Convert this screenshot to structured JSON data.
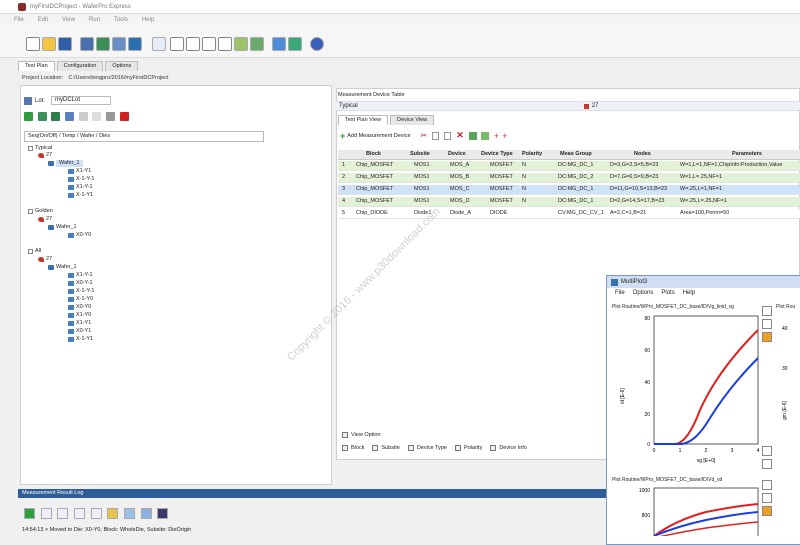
{
  "window": {
    "title": "myFirstDCProject - WaferPro Express"
  },
  "menubar": [
    "File",
    "Edit",
    "View",
    "Run",
    "Tools",
    "Help"
  ],
  "tabs": [
    "Test Plan",
    "Configuration",
    "Options"
  ],
  "project_location": {
    "label": "Project Location:",
    "value": "C:/Users/tengpro/2016/myFirstDCProject"
  },
  "lot": {
    "label": "Lot:",
    "value": "myDCLot"
  },
  "hierarchy_select": "Seq(On/Off) / Temp / Wafer / Dies",
  "tree": [
    {
      "label": "Typical",
      "level": 0
    },
    {
      "label": "27",
      "level": 1
    },
    {
      "label": "Wafer_1",
      "level": 2,
      "selected": true
    },
    {
      "label": "X1-Y1",
      "level": 3
    },
    {
      "label": "X-1-Y-1",
      "level": 3
    },
    {
      "label": "X1-Y-1",
      "level": 3
    },
    {
      "label": "X-1-Y1",
      "level": 3
    },
    {
      "label": "Golden",
      "level": 0
    },
    {
      "label": "27",
      "level": 1
    },
    {
      "label": "Wafer_1",
      "level": 2
    },
    {
      "label": "X0-Y0",
      "level": 3
    },
    {
      "label": "All",
      "level": 0
    },
    {
      "label": "27",
      "level": 1
    },
    {
      "label": "Wafer_1",
      "level": 2
    },
    {
      "label": "X1-Y-1",
      "level": 3
    },
    {
      "label": "X0-Y-1",
      "level": 3
    },
    {
      "label": "X-1-Y-1",
      "level": 3
    },
    {
      "label": "X-1-Y0",
      "level": 3
    },
    {
      "label": "X0-Y0",
      "level": 3
    },
    {
      "label": "X1-Y0",
      "level": 3
    },
    {
      "label": "X1-Y1",
      "level": 3
    },
    {
      "label": "X0-Y1",
      "level": 3
    },
    {
      "label": "X-1-Y1",
      "level": 3
    }
  ],
  "mdt": {
    "title": "Measurement Device Table",
    "typical": "Typical",
    "temp": "27"
  },
  "rtabs": [
    "Test Plan View",
    "Device View"
  ],
  "add_device": "Add Measurement Device",
  "grid": {
    "headers": [
      "Block",
      "Subsite",
      "Device",
      "Device Type",
      "Polarity",
      "Meas Group",
      "Nodes",
      "Parameters"
    ],
    "rows": [
      {
        "n": "1",
        "block": "Chip_MOSFET",
        "subsite": "MOS1",
        "device": "MOS_A",
        "type": "MOSFET",
        "pol": "N",
        "group": "DC:MG_DC_1",
        "nodes": "D=3,G=2,S=5,B=23",
        "params": "W=1,L=1,NF=1,ChipInfo:Production,Value"
      },
      {
        "n": "2",
        "block": "Chip_MOSFET",
        "subsite": "MOS1",
        "device": "MOS_B",
        "type": "MOSFET",
        "pol": "N",
        "group": "DC:MG_DC_2",
        "nodes": "D=7,G=6,S=9,B=23",
        "params": "W=1,L=.25,NF=1"
      },
      {
        "n": "3",
        "block": "Chip_MOSFET",
        "subsite": "MOS1",
        "device": "MOS_C",
        "type": "MOSFET",
        "pol": "N",
        "group": "DC:MG_DC_1",
        "nodes": "D=11,G=10,S=13,B=23",
        "params": "W=.25,L=1,NF=1"
      },
      {
        "n": "4",
        "block": "Chip_MOSFET",
        "subsite": "MOS1",
        "device": "MOS_D",
        "type": "MOSFET",
        "pol": "N",
        "group": "DC:MG_DC_1",
        "nodes": "D=2,G=14,S=17,B=23",
        "params": "W=.25,L=.25,NF=1"
      },
      {
        "n": "5",
        "block": "Chip_DIODE",
        "subsite": "Diode1",
        "device": "Diode_A",
        "type": "DIODE",
        "pol": "",
        "group": "CV:MG_DC_CV_1",
        "nodes": "A=2,C=1,B=21",
        "params": "Area=100,Perim=50"
      }
    ]
  },
  "view_option": "View Option",
  "col_options": [
    "Block",
    "Subsite",
    "Device Type",
    "Polarity",
    "Device Info"
  ],
  "log": {
    "title": "Measurement Result Log",
    "line": "14:54:13 > Moved to Die: X0-Y0, Block: WholeDie, Subsite: DieOrigin"
  },
  "multiplot": {
    "title": "MultiPlot3",
    "menu": [
      "File",
      "Options",
      "Plots",
      "Help"
    ],
    "plot1_title": "Plot Routine/WPro_MOSFET_DC_base/ID/Vg_linid_vg",
    "plot1_ylabel": "id [E-6]",
    "plot1_xlabel": "vg [E+0]",
    "plot1_yticks": [
      "80",
      "60",
      "40",
      "20",
      "0"
    ],
    "plot1_xticks": [
      "0",
      "1",
      "2",
      "3",
      "4"
    ],
    "plot2_title": "Plot Routine/WPro_MOSFET_DC_base/ID/Vd_vd",
    "plot2_yticks": [
      "1000",
      "800"
    ],
    "side_title": "Plot Rou",
    "side_ylabel": "gm [E-6]",
    "side_ticks": [
      "40",
      "30"
    ],
    "colors": {
      "red": "#e02020",
      "blue": "#1a3ee0"
    }
  },
  "watermark": "Copyright © 2016 - www.p30download.com"
}
